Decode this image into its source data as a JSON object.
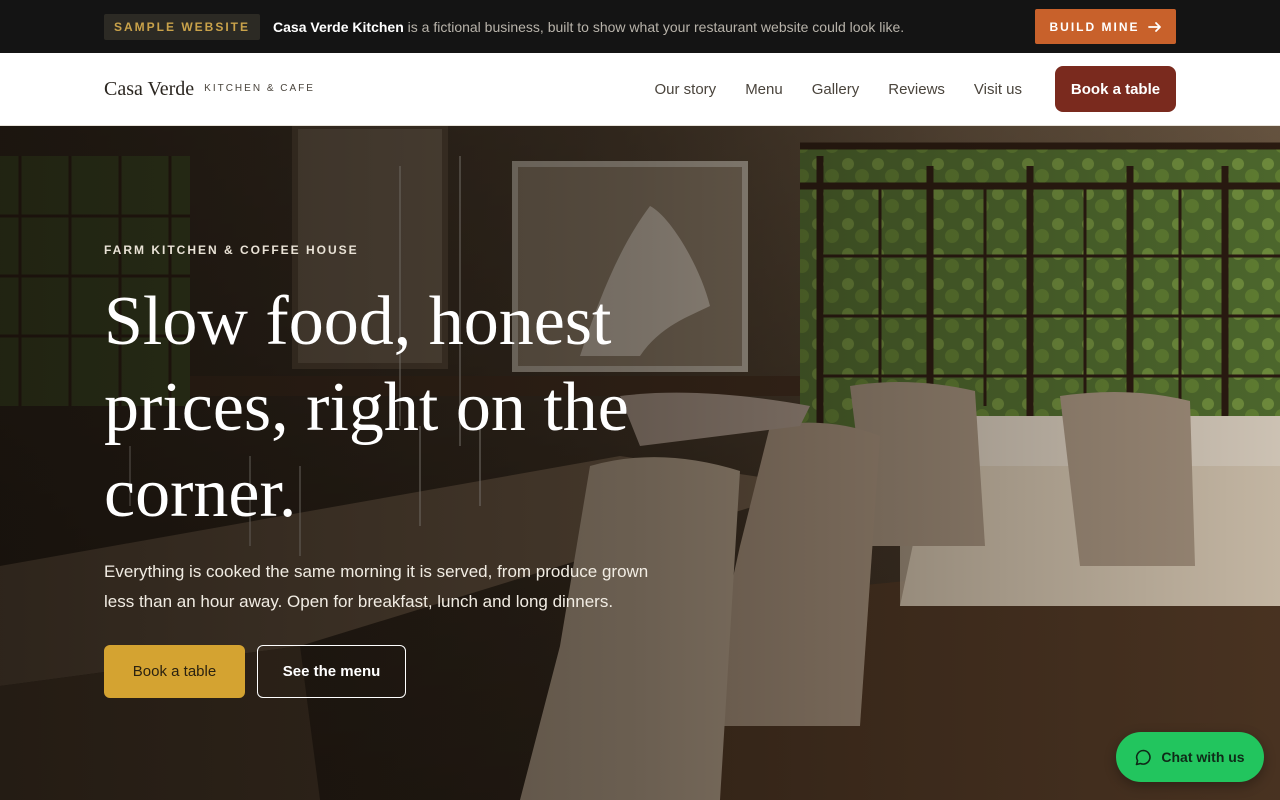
{
  "banner": {
    "badge": "SAMPLE WEBSITE",
    "business_name": "Casa Verde Kitchen",
    "text": " is a fictional business, built to show what your restaurant website could look like.",
    "cta": "BUILD MINE",
    "cta_icon": "arrow-right-icon"
  },
  "nav": {
    "logo": "Casa Verde",
    "logo_sub": "KITCHEN & CAFE",
    "links": [
      "Our story",
      "Menu",
      "Gallery",
      "Reviews",
      "Visit us"
    ],
    "cta": "Book a table"
  },
  "hero": {
    "eyebrow": "FARM KITCHEN & COFFEE HOUSE",
    "headline": "Slow food, honest prices, right on the corner.",
    "lede": "Everything is cooked the same morning it is served, from produce grown less than an hour away. Open for breakfast, lunch and long dinners.",
    "primary_button": "Book a table",
    "secondary_button": "See the menu"
  },
  "chat": {
    "label": "Chat with us",
    "icon": "chat-bubble-icon"
  },
  "colors": {
    "banner_cta": "#c8612b",
    "nav_cta": "#7a2a1e",
    "hero_primary": "#d4a331",
    "chat": "#22c55e"
  }
}
